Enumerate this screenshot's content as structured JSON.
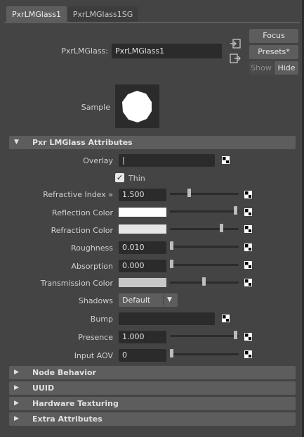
{
  "tabs": [
    {
      "label": "PxrLMGlass1",
      "active": true
    },
    {
      "label": "PxrLMGlass1SG",
      "active": false
    }
  ],
  "header": {
    "node_label": "PxrLMGlass:",
    "node_name": "PxrLMGlass1",
    "focus_label": "Focus",
    "presets_label": "Presets*",
    "show_label": "Show",
    "hide_label": "Hide"
  },
  "sample": {
    "label": "Sample"
  },
  "sections": {
    "main_title": "Pxr  LMGlass Attributes",
    "node_behavior": "Node Behavior",
    "uuid": "UUID",
    "hardware_texturing": "Hardware Texturing",
    "extra_attributes": "Extra Attributes"
  },
  "attributes": {
    "overlay": {
      "label": "Overlay",
      "value": "|"
    },
    "thin": {
      "label": "Thin",
      "checked": true
    },
    "refractive_index": {
      "label": "Refractive Index »",
      "value": "1.500",
      "level": 0.27
    },
    "reflection_color": {
      "label": "Reflection Color",
      "color": "#ffffff",
      "level": 1.0
    },
    "refraction_color": {
      "label": "Refraction Color",
      "color": "#e6e6e6",
      "level": 0.78
    },
    "roughness": {
      "label": "Roughness",
      "value": "0.010",
      "level": 0.0
    },
    "absorption": {
      "label": "Absorption",
      "value": "0.000",
      "level": 0.0
    },
    "transmission_color": {
      "label": "Transmission Color",
      "color": "#c8c8c8",
      "level": 0.5
    },
    "shadows": {
      "label": "Shadows",
      "value": "Default"
    },
    "bump": {
      "label": "Bump"
    },
    "presence": {
      "label": "Presence",
      "value": "1.000",
      "level": 1.0
    },
    "input_aov": {
      "label": "Input AOV",
      "value": "0",
      "level": 0.0
    }
  },
  "icons": {
    "map": "checker-map-icon",
    "collapse": "triangle-down-icon",
    "expand": "triangle-right-icon"
  }
}
